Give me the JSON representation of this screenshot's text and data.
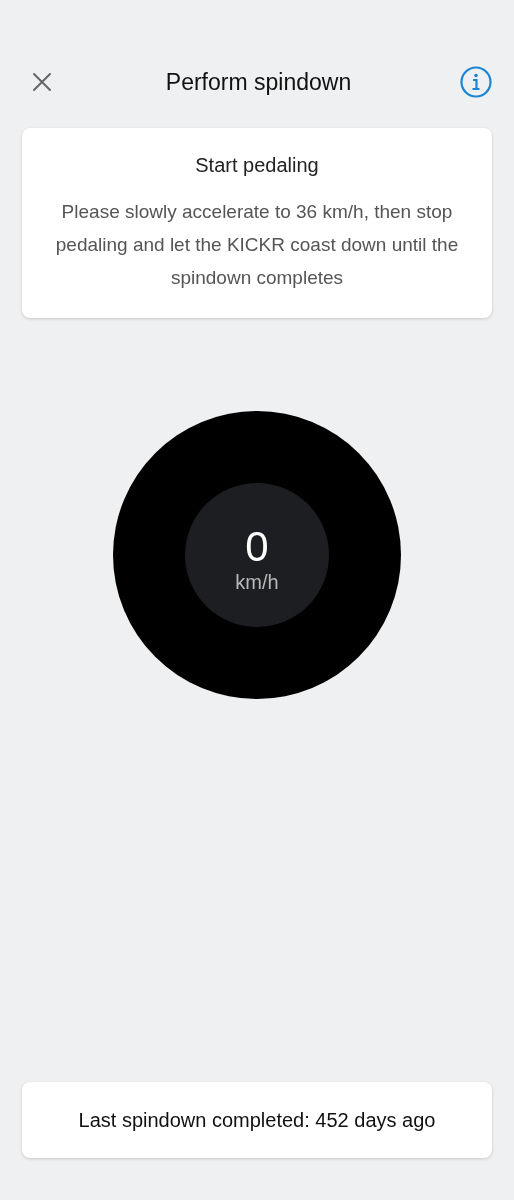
{
  "header": {
    "title": "Perform spindown"
  },
  "instruction_card": {
    "title": "Start pedaling",
    "body": "Please slowly accelerate to 36 km/h, then stop pedaling and let the KICKR coast down until the spindown completes"
  },
  "speed_gauge": {
    "value": "0",
    "unit": "km/h"
  },
  "status_card": {
    "text": "Last spindown completed: 452 days ago"
  }
}
